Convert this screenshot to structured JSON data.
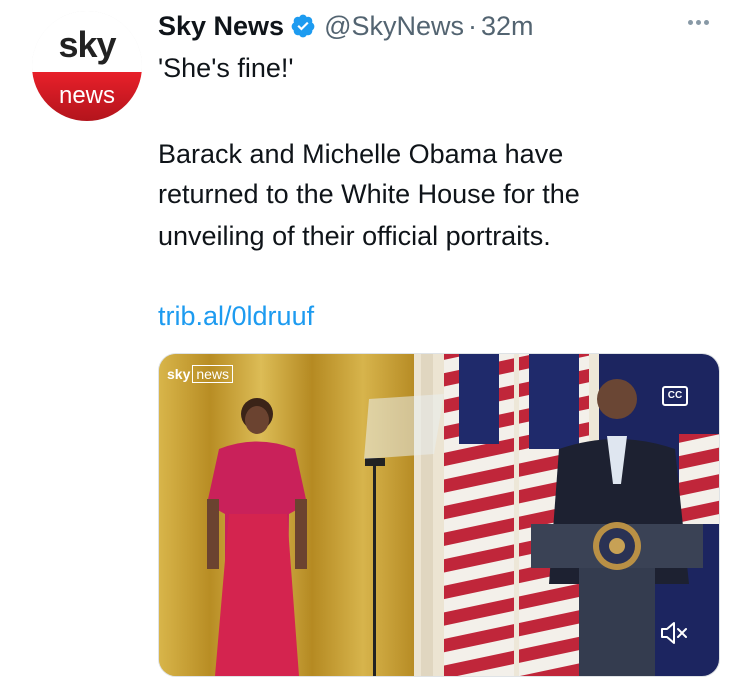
{
  "account": {
    "display_name": "Sky News",
    "handle": "@SkyNews",
    "separator": "·",
    "time_ago": "32m",
    "avatar_logo_top": "sky",
    "avatar_logo_bottom": "news"
  },
  "tweet": {
    "line1": "'She's fine!'",
    "line2": "Barack and Michelle Obama have",
    "line3": "returned to the White House for the",
    "line4": "unveiling of their official portraits.",
    "link": "trib.al/0ldruuf"
  },
  "media": {
    "watermark_sky": "sky",
    "watermark_news": "news",
    "cc_label": "CC"
  },
  "colors": {
    "link": "#1d9bf0",
    "verified": "#1d9bf0",
    "sky_red": "#e8202a",
    "muted_text": "#536471"
  },
  "icons": [
    "verified-badge-icon",
    "more-options-icon",
    "closed-captions-icon",
    "mute-icon"
  ]
}
